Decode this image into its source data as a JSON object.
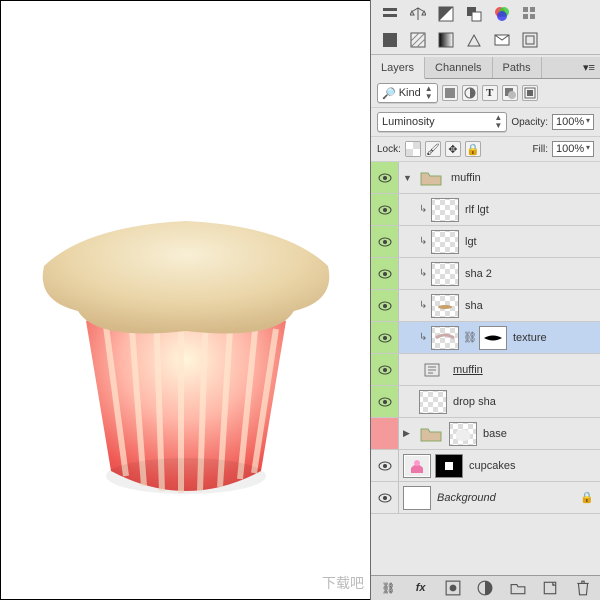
{
  "tabs": {
    "layers": "Layers",
    "channels": "Channels",
    "paths": "Paths"
  },
  "filter": {
    "select": "Kind"
  },
  "blend": {
    "mode": "Luminosity",
    "opacitylbl": "Opacity:",
    "opacity": "100%"
  },
  "lock": {
    "label": "Lock:",
    "filllbl": "Fill:",
    "fill": "100%"
  },
  "layers": {
    "muffin_group": "muffin",
    "rlf_lgt": "rlf lgt",
    "lgt": "lgt",
    "sha2": "sha 2",
    "sha": "sha",
    "texture": "texture",
    "muffin_link": "muffin",
    "drop_sha": "drop sha",
    "base": "base",
    "cupcakes": "cupcakes",
    "background": "Background"
  },
  "watermark": "下载吧"
}
